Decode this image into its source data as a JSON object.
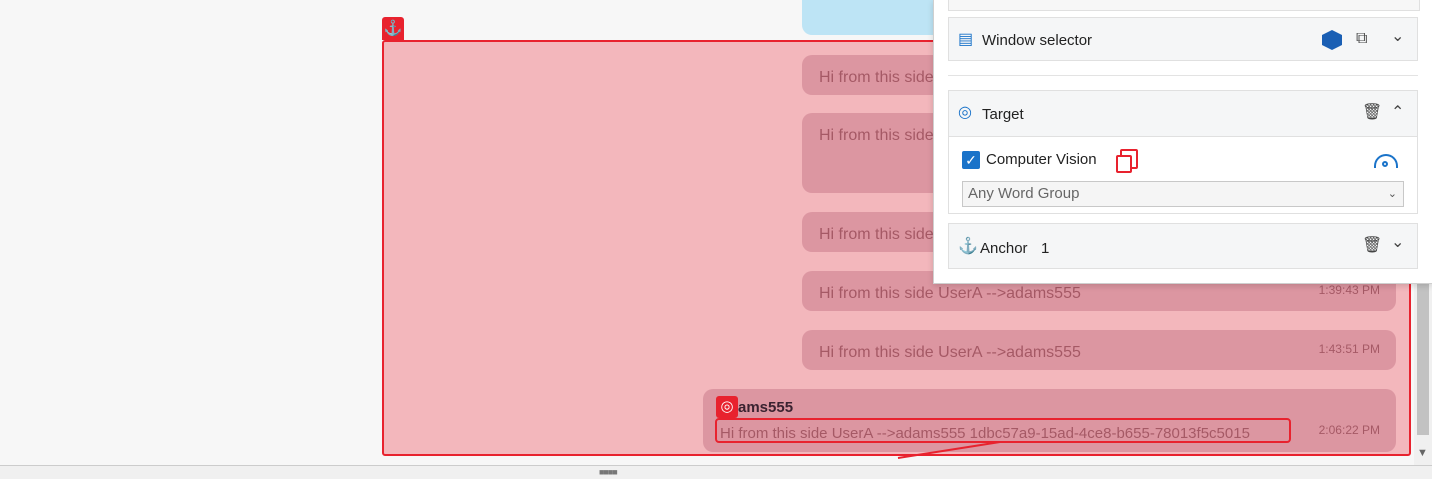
{
  "chat": {
    "messages": [
      {
        "text": "Hi from this side",
        "time": ""
      },
      {
        "text": "Hi from this side",
        "time": ""
      },
      {
        "text": "Hi from this side",
        "time": ""
      },
      {
        "text": "Hi from this side UserA -->adams555",
        "time": "1:39:43 PM"
      },
      {
        "text": "Hi from this side UserA -->adams555",
        "time": "1:43:51 PM"
      }
    ],
    "last": {
      "sender": "ams555",
      "text": "Hi from this side UserA -->adams555 1dbc57a9-15ad-4ce8-b655-78013f5c5015",
      "time": "2:06:22 PM"
    }
  },
  "panel": {
    "window_selector": "Window selector",
    "target": "Target",
    "computer_vision": "Computer Vision",
    "dropdown_value": "Any Word Group",
    "anchor_label": "Anchor",
    "anchor_count": "1"
  },
  "colors": {
    "highlight": "#e8222e",
    "accent": "#1a73c9"
  },
  "icons": [
    "anchor-icon",
    "target-icon",
    "window-icon",
    "delete-icon",
    "chevron-up-icon",
    "chevron-down-icon",
    "copy-icon",
    "eye-icon",
    "checkmark-icon"
  ]
}
